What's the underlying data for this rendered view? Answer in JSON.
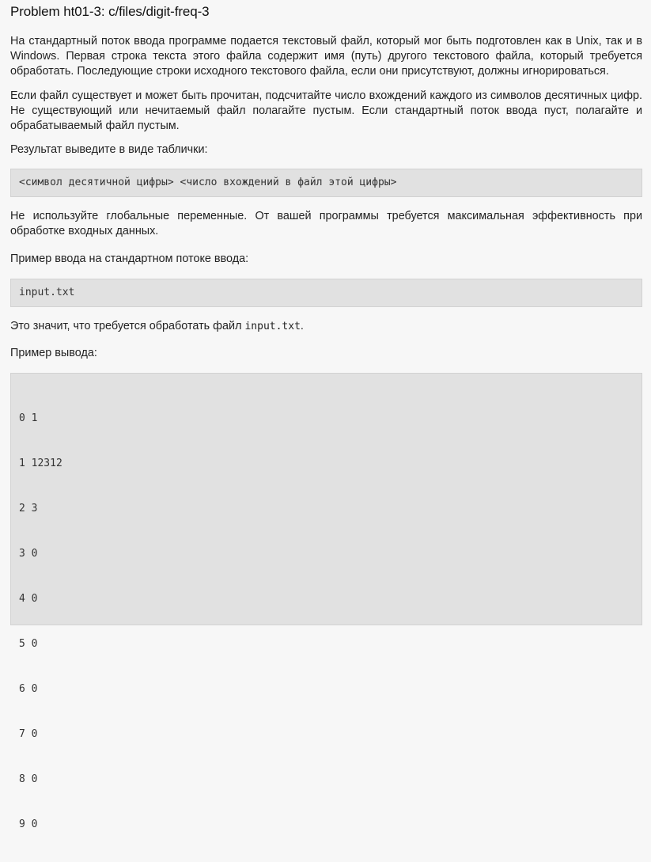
{
  "problem": {
    "title": "Problem ht01-3: c/files/digit-freq-3",
    "paragraph1": "На стандартный поток ввода программе подается текстовый файл, который мог быть подготовлен как в Unix, так и в Windows. Первая строка текста этого файла содержит имя (путь) другого текстового файла, который требуется обработать. Последующие строки исходного текстового файла, если они присутствуют, должны игнорироваться.",
    "paragraph2": "Если файл существует и может быть прочитан, подсчитайте число вхождений каждого из символов десятичных цифр. Не существующий или нечитаемый файл полагайте пустым. Если стандартный поток ввода пуст, полагайте и обрабатываемый файл пустым.",
    "result_label": "Результат выведите в виде таблички:",
    "format_code": "<символ десятичной цифры> <число вхождений в файл этой цифры>",
    "paragraph3": "Не используйте глобальные переменные. От вашей программы требуется максимальная эффективность при обработке входных данных.",
    "input_example_label": "Пример ввода на стандартном потоке ввода:",
    "input_example": "input.txt",
    "explain_prefix": "Это значит, что требуется обработать файл ",
    "explain_code": "input.txt",
    "explain_suffix": ".",
    "output_example_label": "Пример вывода:",
    "output_lines": [
      "0 1",
      "1 12312",
      "2 3",
      "3 0",
      "4 0",
      "5 0",
      "6 0",
      "7 0",
      "8 0",
      "9 0"
    ]
  }
}
